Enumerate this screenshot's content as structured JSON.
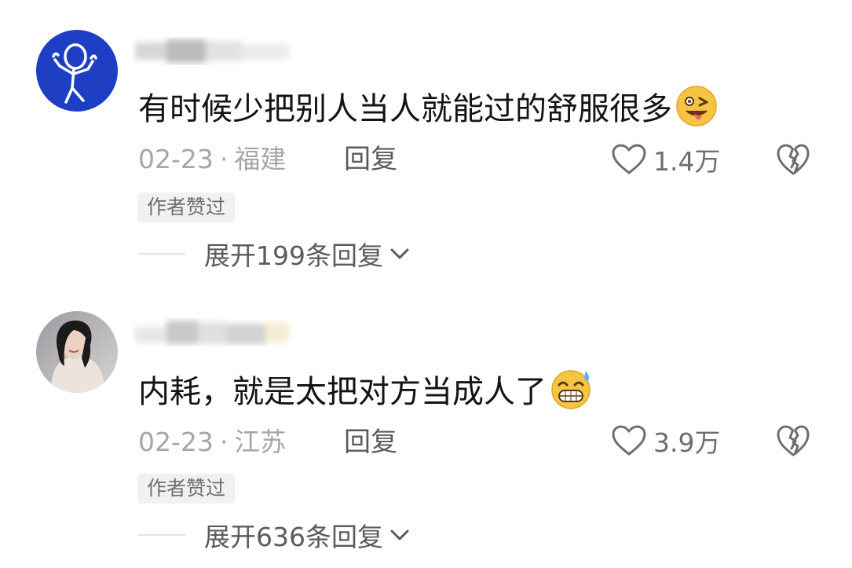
{
  "comments": [
    {
      "avatar": "stick-figure-avatar",
      "content": "有时候少把别人当人就能过的舒服很多",
      "emoji": "winking-tongue-emoji",
      "date": "02-23",
      "separator": "·",
      "location": "福建",
      "reply_label": "回复",
      "like_count": "1.4万",
      "author_badge": "作者赞过",
      "expand_label": "展开199条回复"
    },
    {
      "avatar": "woman-photo-avatar",
      "content": "内耗，就是太把对方当成人了",
      "emoji": "grinning-sweat-emoji",
      "date": "02-23",
      "separator": "·",
      "location": "江苏",
      "reply_label": "回复",
      "like_count": "3.9万",
      "author_badge": "作者赞过",
      "expand_label": "展开636条回复"
    }
  ],
  "colors": {
    "text_primary": "#141414",
    "text_secondary": "#a6a6a8",
    "text_action": "#5b5b5f",
    "badge_bg": "#f1f1f3",
    "avatar_blue": "#1e3fc4"
  }
}
